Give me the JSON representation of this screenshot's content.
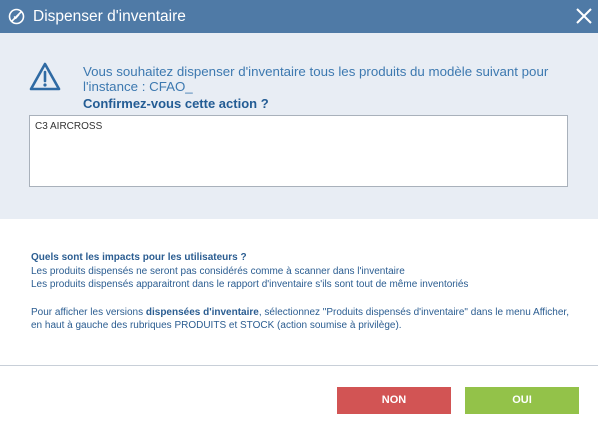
{
  "window": {
    "title": "Dispenser d'inventaire",
    "titlebar_color": "#4f7aa6"
  },
  "icons": {
    "title_icon": "no-entry-icon",
    "close": "close-icon",
    "warning": "warning-triangle-icon"
  },
  "message": {
    "question": "Vous souhaitez dispenser d'inventaire tous les produits du modèle suivant pour l'instance : CFAO_",
    "confirm": "Confirmez-vous cette action ?"
  },
  "model_box": {
    "value": "C3 AIRCROSS"
  },
  "info": {
    "title": "Quels sont les impacts pour les utilisateurs ?",
    "line1": "Les produits dispensés ne seront pas considérés comme à scanner dans l'inventaire",
    "line2": "Les produits dispensés apparaitront dans le rapport d'inventaire s'ils sont tout de même inventoriés",
    "para_before": "Pour afficher les versions ",
    "para_bold": "dispensées d'inventaire",
    "para_after": ", sélectionnez \"Produits dispensés d'inventaire\" dans le menu Afficher, en haut à gauche des rubriques PRODUITS et STOCK (action soumise à privilège)."
  },
  "buttons": {
    "no_label": "NON",
    "yes_label": "OUI",
    "no_color": "#d25454",
    "yes_color": "#93c249"
  }
}
